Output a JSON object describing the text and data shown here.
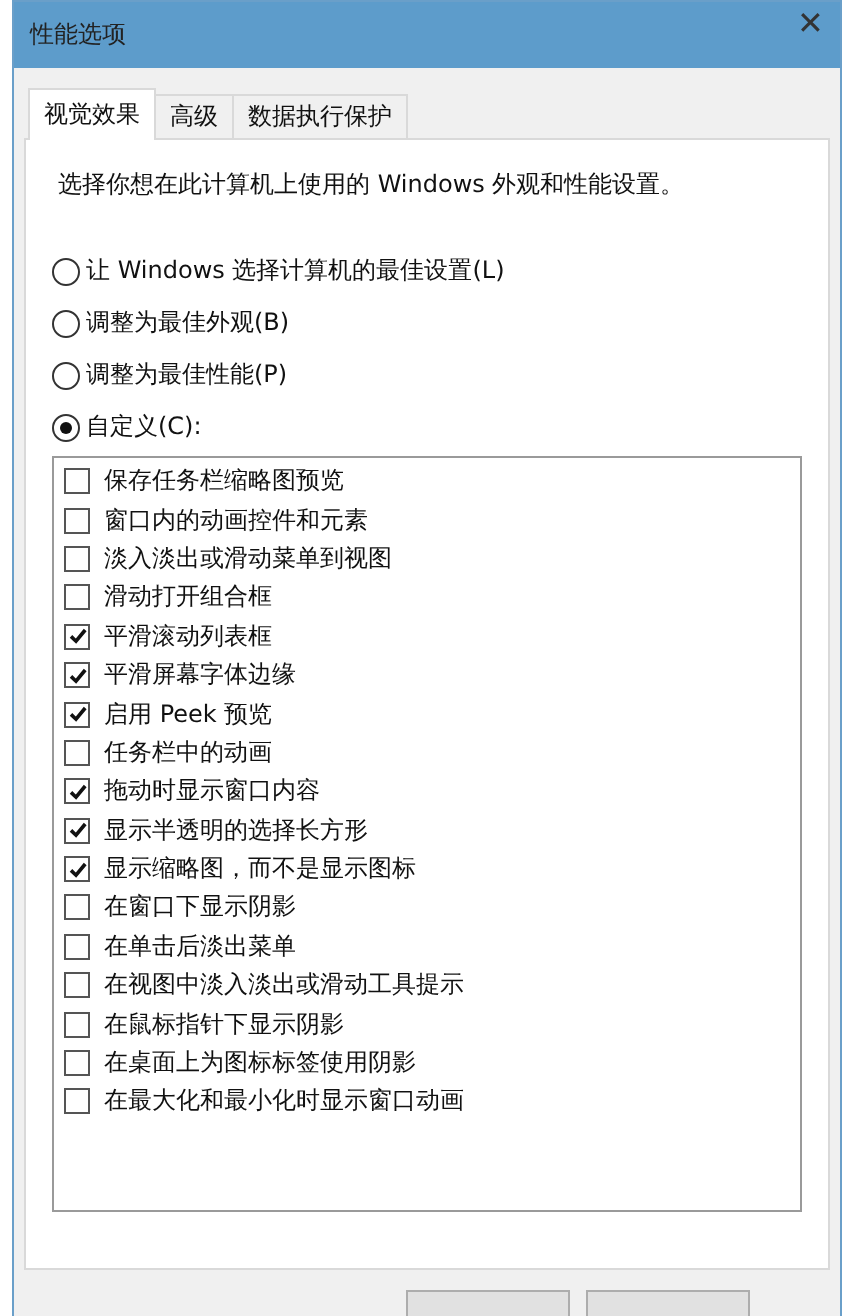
{
  "window": {
    "title": "性能选项",
    "close": "✕"
  },
  "tabs": [
    {
      "label": "视觉效果",
      "selected": true
    },
    {
      "label": "高级",
      "selected": false
    },
    {
      "label": "数据执行保护",
      "selected": false
    }
  ],
  "description": "选择你想在此计算机上使用的 Windows 外观和性能设置。",
  "options": [
    {
      "label": "让 Windows 选择计算机的最佳设置(L)",
      "selected": false
    },
    {
      "label": "调整为最佳外观(B)",
      "selected": false
    },
    {
      "label": "调整为最佳性能(P)",
      "selected": false
    },
    {
      "label": "自定义(C):",
      "selected": true
    }
  ],
  "effects": [
    {
      "label": "保存任务栏缩略图预览",
      "checked": false
    },
    {
      "label": "窗口内的动画控件和元素",
      "checked": false
    },
    {
      "label": "淡入淡出或滑动菜单到视图",
      "checked": false
    },
    {
      "label": "滑动打开组合框",
      "checked": false
    },
    {
      "label": "平滑滚动列表框",
      "checked": true
    },
    {
      "label": "平滑屏幕字体边缘",
      "checked": true
    },
    {
      "label": "启用 Peek 预览",
      "checked": true
    },
    {
      "label": "任务栏中的动画",
      "checked": false
    },
    {
      "label": "拖动时显示窗口内容",
      "checked": true
    },
    {
      "label": "显示半透明的选择长方形",
      "checked": true
    },
    {
      "label": "显示缩略图，而不是显示图标",
      "checked": true
    },
    {
      "label": "在窗口下显示阴影",
      "checked": false
    },
    {
      "label": "在单击后淡出菜单",
      "checked": false
    },
    {
      "label": "在视图中淡入淡出或滑动工具提示",
      "checked": false
    },
    {
      "label": "在鼠标指针下显示阴影",
      "checked": false
    },
    {
      "label": "在桌面上为图标标签使用阴影",
      "checked": false
    },
    {
      "label": "在最大化和最小化时显示窗口动画",
      "checked": false
    }
  ]
}
